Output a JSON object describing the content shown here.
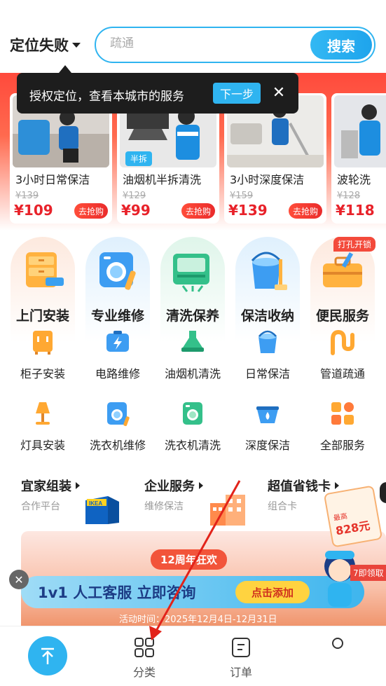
{
  "header": {
    "location_label": "定位失败",
    "search_placeholder": "疏通",
    "search_button": "搜索"
  },
  "tooltip": {
    "text": "授权定位，查看本城市的服务",
    "next_button": "下一步",
    "close_icon": "close-icon"
  },
  "flash_deals": [
    {
      "title": "3小时日常保洁",
      "old_price": "¥139",
      "price": "¥109",
      "buy_label": "去抢购",
      "tag": ""
    },
    {
      "title": "油烟机半拆清洗",
      "old_price": "¥129",
      "price": "¥99",
      "buy_label": "去抢购",
      "tag": "半拆"
    },
    {
      "title": "3小时深度保洁",
      "old_price": "¥159",
      "price": "¥139",
      "buy_label": "去抢购",
      "tag": ""
    },
    {
      "title": "波轮洗",
      "old_price": "¥128",
      "price": "¥118",
      "buy_label": "",
      "tag": ""
    }
  ],
  "main_categories": [
    {
      "label": "上门安装",
      "icon": "drawer-toolbox-icon",
      "color": "#fdeee5"
    },
    {
      "label": "专业维修",
      "icon": "washer-wrench-icon",
      "color": "#e6f3fd"
    },
    {
      "label": "清洗保养",
      "icon": "ac-unit-icon",
      "color": "#e6f7ef"
    },
    {
      "label": "保洁收纳",
      "icon": "bucket-mop-icon",
      "color": "#e6f3fd"
    },
    {
      "label": "便民服务",
      "icon": "toolbox-icon",
      "color": "#fdeee5",
      "badge": "打孔开锁"
    }
  ],
  "sub_categories_row1": [
    {
      "label": "柜子安装",
      "icon": "cabinet-icon"
    },
    {
      "label": "电路维修",
      "icon": "battery-lightning-icon"
    },
    {
      "label": "油烟机清洗",
      "icon": "range-hood-icon"
    },
    {
      "label": "日常保洁",
      "icon": "bucket-icon"
    },
    {
      "label": "管道疏通",
      "icon": "pipe-icon"
    }
  ],
  "sub_categories_row2": [
    {
      "label": "灯具安装",
      "icon": "lamp-icon"
    },
    {
      "label": "洗衣机维修",
      "icon": "washer-repair-icon"
    },
    {
      "label": "洗衣机清洗",
      "icon": "washer-clean-icon"
    },
    {
      "label": "深度保洁",
      "icon": "basin-drop-icon"
    },
    {
      "label": "全部服务",
      "icon": "grid-apps-icon"
    }
  ],
  "promos": [
    {
      "title": "宜家组装",
      "subtitle": "合作平台",
      "image_text": "IKEA"
    },
    {
      "title": "企业服务",
      "subtitle": "维修保洁"
    },
    {
      "title": "超值省钱卡",
      "subtitle": "组合卡",
      "coupon_small": "最高",
      "coupon_amount": "828元"
    }
  ],
  "promo_banner": {
    "anniversary": "12周年狂欢",
    "consult_text": "1v1 人工客服 立即咨询",
    "add_button": "点击添加",
    "activity_time": "活动时间：2025年12月4日-12月31日",
    "right_tag": "7即领取"
  },
  "tabbar": {
    "top_icon": "arrow-up-icon",
    "tabs": [
      {
        "label": "分类",
        "icon": "grid-icon"
      },
      {
        "label": "订单",
        "icon": "order-list-icon"
      },
      {
        "label": "",
        "icon": "profile-icon"
      }
    ]
  },
  "colors": {
    "accent": "#2fb4f0",
    "price_red": "#e8222a",
    "banner_red": "#ff4a3c"
  }
}
